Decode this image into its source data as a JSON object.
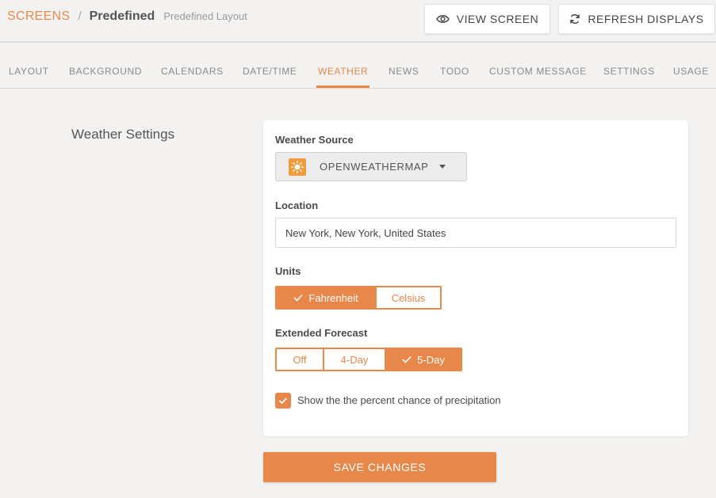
{
  "breadcrumb": {
    "root": "SCREENS",
    "separator": "/",
    "title": "Predefined",
    "subtitle": "Predefined Layout"
  },
  "header_actions": {
    "view_screen": "VIEW SCREEN",
    "refresh_displays": "REFRESH DISPLAYS"
  },
  "tabs": [
    {
      "label": "LAYOUT"
    },
    {
      "label": "BACKGROUND"
    },
    {
      "label": "CALENDARS"
    },
    {
      "label": "DATE/TIME"
    },
    {
      "label": "WEATHER",
      "active": true
    },
    {
      "label": "NEWS"
    },
    {
      "label": "TODO"
    },
    {
      "label": "CUSTOM MESSAGE"
    },
    {
      "label": "SETTINGS"
    },
    {
      "label": "USAGE"
    }
  ],
  "weather": {
    "section_title": "Weather Settings",
    "source": {
      "label": "Weather Source",
      "selected": "OPENWEATHERMAP",
      "icon": "sun-icon"
    },
    "location": {
      "label": "Location",
      "value": "New York, New York, United States"
    },
    "units": {
      "label": "Units",
      "options": [
        "Fahrenheit",
        "Celsius"
      ],
      "selected": "Fahrenheit"
    },
    "forecast": {
      "label": "Extended Forecast",
      "options": [
        "Off",
        "4-Day",
        "5-Day"
      ],
      "selected": "5-Day"
    },
    "precipitation": {
      "label": "Show the the percent chance of precipitation",
      "checked": true
    },
    "save_label": "SAVE CHANGES"
  },
  "colors": {
    "accent": "#e8874a",
    "background": "#f3f2f1",
    "card": "#ffffff"
  }
}
